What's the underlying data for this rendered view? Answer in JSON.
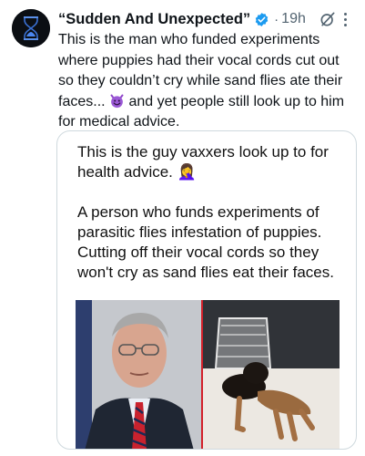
{
  "post": {
    "author_name": "“Sudden And Unexpected”",
    "separator": "·",
    "timestamp": "19h",
    "text_before_emoji": "This is the man who funded experiments where puppies had their vocal cords cut out so they couldn’t cry while sand flies ate their faces... ",
    "text_after_emoji": " and yet people still look up to him for medical advice.",
    "emoji_icon": "smiling-devil-emoji",
    "verified_color": "#1d9bf0"
  },
  "card": {
    "line1": "This is the guy vaxxers look up to for health advice. 🤦‍♀️",
    "line2": "A person who funds experiments of parasitic flies infestation of puppies. Cutting off their vocal cords so they won't cry as sand flies eat their faces."
  },
  "icons": {
    "verified": "verified-badge-icon",
    "grok": "grok-icon",
    "more": "more-options-icon"
  }
}
